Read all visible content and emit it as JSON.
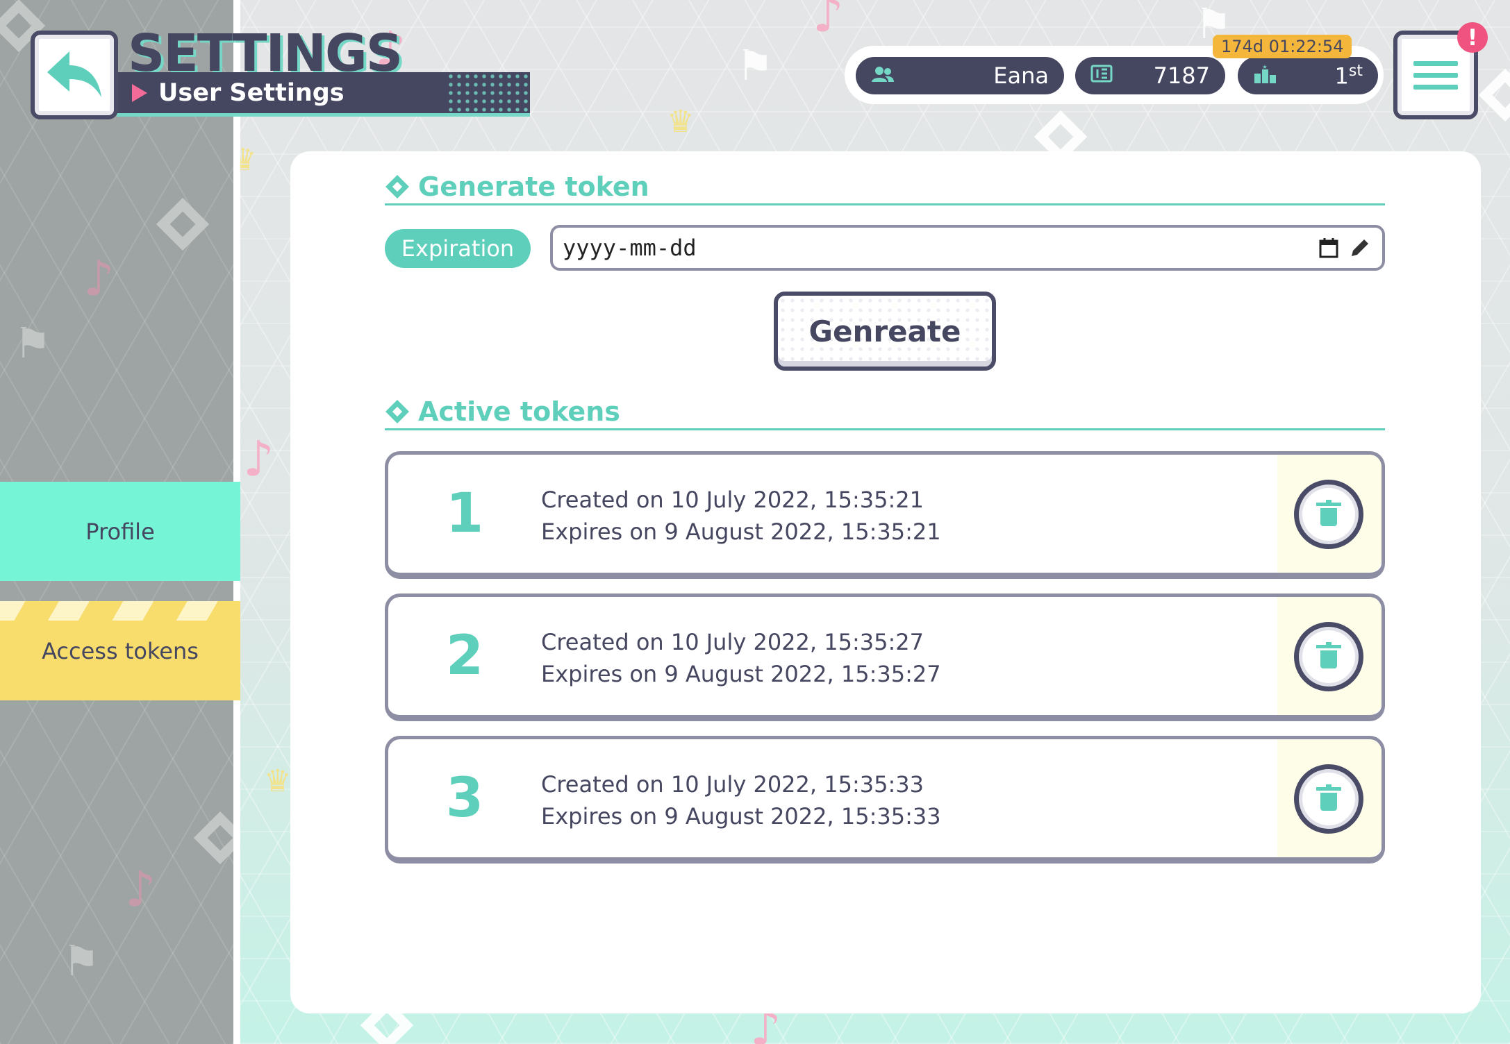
{
  "header": {
    "title": "SETTINGS",
    "subtitle": "User Settings"
  },
  "stats": {
    "username": "Eana",
    "points": "7187",
    "rank_number": "1",
    "rank_suffix": "st",
    "timer": "174d 01:22:54",
    "alert": "!"
  },
  "sidebar": {
    "items": [
      {
        "label": "Profile"
      },
      {
        "label": "Access tokens"
      }
    ]
  },
  "generate": {
    "heading": "Generate token",
    "expiration_label": "Expiration",
    "date_placeholder": "yyyy-mm-dd",
    "button": "Genreate"
  },
  "active": {
    "heading": "Active tokens",
    "tokens": [
      {
        "number": "1",
        "created": "Created on 10 July 2022, 15:35:21",
        "expires": "Expires on 9 August 2022, 15:35:21"
      },
      {
        "number": "2",
        "created": "Created on 10 July 2022, 15:35:27",
        "expires": "Expires on 9 August 2022, 15:35:27"
      },
      {
        "number": "3",
        "created": "Created on 10 July 2022, 15:35:33",
        "expires": "Expires on 9 August 2022, 15:35:33"
      }
    ]
  },
  "icons": {
    "back": "back-arrow-icon",
    "menu": "hamburger-menu-icon",
    "user": "users-icon",
    "points": "points-card-icon",
    "rank": "ranking-icon",
    "calendar": "calendar-icon",
    "edit": "pencil-icon",
    "delete": "trash-icon"
  },
  "colors": {
    "accent": "#5ecfbb",
    "dark": "#45465f",
    "profile_bg": "#75f5d6",
    "tokens_bg": "#f8dd6d",
    "timer_bg": "#f5b73b",
    "alert": "#f0537f"
  }
}
